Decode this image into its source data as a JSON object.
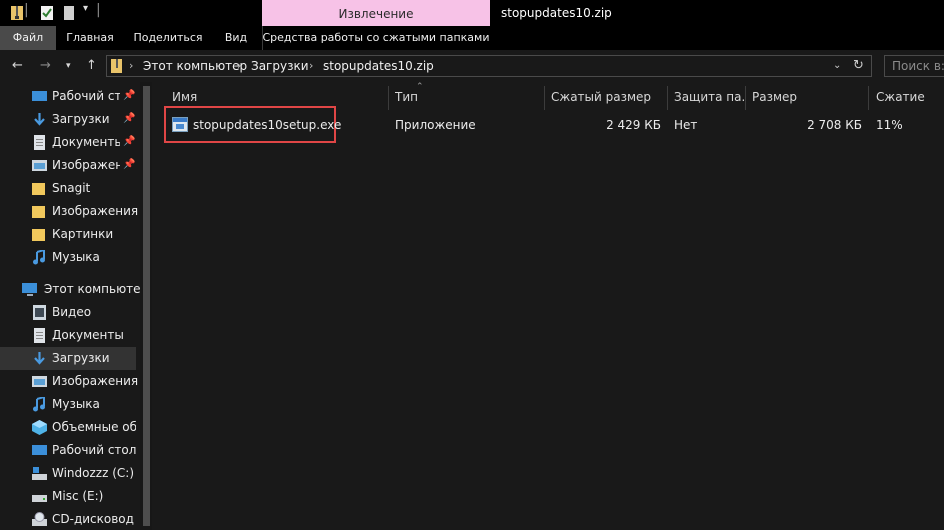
{
  "window": {
    "title": "stopupdates10.zip",
    "context_tab": "Извлечение"
  },
  "ribbon": {
    "tabs": [
      "Файл",
      "Главная",
      "Поделиться",
      "Вид"
    ],
    "context_tools": "Средства работы со сжатыми папками"
  },
  "address": {
    "crumbs": [
      "Этот компьютер",
      "Загрузки",
      "stopupdates10.zip"
    ],
    "search_placeholder": "Поиск в: s"
  },
  "sidebar": {
    "quick_access": [
      {
        "label": "Рабочий сто.",
        "icon": "desktop-icon",
        "pinned": true
      },
      {
        "label": "Загрузки",
        "icon": "download-icon",
        "pinned": true
      },
      {
        "label": "Документы",
        "icon": "documents-icon",
        "pinned": true
      },
      {
        "label": "Изображени",
        "icon": "pictures-icon",
        "pinned": true
      },
      {
        "label": "Snagit",
        "icon": "folder-icon",
        "pinned": false
      },
      {
        "label": "Изображения",
        "icon": "folder-icon",
        "pinned": false
      },
      {
        "label": "Картинки",
        "icon": "folder-icon",
        "pinned": false
      },
      {
        "label": "Музыка",
        "icon": "music-icon",
        "pinned": false
      }
    ],
    "this_pc": "Этот компьютер",
    "pc_items": [
      {
        "label": "Видео",
        "icon": "video-icon"
      },
      {
        "label": "Документы",
        "icon": "documents-icon"
      },
      {
        "label": "Загрузки",
        "icon": "download-icon",
        "selected": true
      },
      {
        "label": "Изображения",
        "icon": "pictures-icon"
      },
      {
        "label": "Музыка",
        "icon": "music-icon"
      },
      {
        "label": "Объемные объ",
        "icon": "3d-objects-icon"
      },
      {
        "label": "Рабочий стол",
        "icon": "desktop-icon"
      },
      {
        "label": "Windozzz (C:)",
        "icon": "windows-drive-icon"
      },
      {
        "label": "Misc (E:)",
        "icon": "drive-icon"
      },
      {
        "label": "CD-дисковод (G",
        "icon": "cd-drive-icon"
      }
    ]
  },
  "columns": {
    "name": "Имя",
    "type": "Тип",
    "compressed_size": "Сжатый размер",
    "protection": "Защита па...",
    "size": "Размер",
    "ratio": "Сжатие"
  },
  "files": [
    {
      "name": "stopupdates10setup.exe",
      "type": "Приложение",
      "compressed_size": "2 429 КБ",
      "protection": "Нет",
      "size": "2 708 КБ",
      "ratio": "11%"
    }
  ],
  "colors": {
    "background": "#191919",
    "context_tab": "#f7c2e7",
    "highlight_box": "#e04646",
    "selected_item": "#333333"
  }
}
